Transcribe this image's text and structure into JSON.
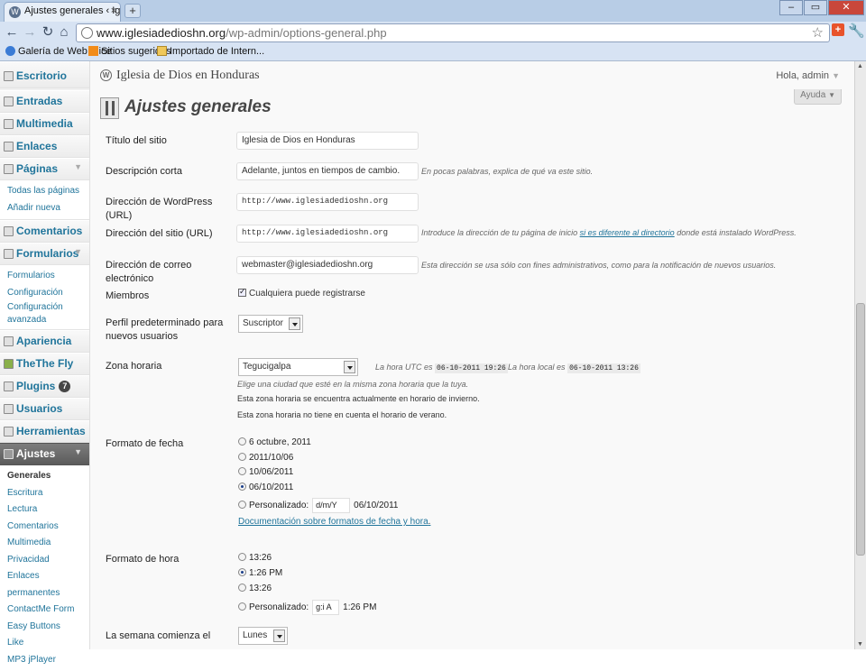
{
  "browser": {
    "tab_title": "Ajustes generales ‹ Iglesia d",
    "url_host": "www.iglesiadedioshn.org",
    "url_path": "/wp-admin/options-general.php",
    "bookmarks": [
      "Galería de Web Slice",
      "Sitios sugeridos",
      "Importado de Intern..."
    ]
  },
  "admin_bar": {
    "site_name": "Iglesia de Dios en Honduras",
    "greeting": "Hola, admin",
    "help": "Ayuda"
  },
  "sidebar": {
    "escritorio": "Escritorio",
    "entradas": "Entradas",
    "multimedia": "Multimedia",
    "enlaces": "Enlaces",
    "paginas": "Páginas",
    "paginas_sub": [
      "Todas las páginas",
      "Añadir nueva"
    ],
    "comentarios": "Comentarios",
    "formularios": "Formularios",
    "formularios_sub": [
      "Formularios",
      "Configuración",
      "Configuración",
      "avanzada"
    ],
    "apariencia": "Apariencia",
    "thethe": "TheThe Fly",
    "plugins": "Plugins",
    "plugins_count": "7",
    "usuarios": "Usuarios",
    "herramientas": "Herramientas",
    "ajustes": "Ajustes",
    "ajustes_sub": [
      "Generales",
      "Escritura",
      "Lectura",
      "Comentarios",
      "Multimedia",
      "Privacidad",
      "Enlaces permanentes",
      "ContactMe Form",
      "Easy Buttons",
      "Like",
      "MP3 jPlayer"
    ]
  },
  "page": {
    "title": "Ajustes generales",
    "fields": {
      "site_title_label": "Título del sitio",
      "site_title_value": "Iglesia de Dios en Honduras",
      "tagline_label": "Descripción corta",
      "tagline_value": "Adelante, juntos en tiempos de cambio.",
      "tagline_desc": "En pocas palabras, explica de qué va este sitio.",
      "wp_url_label": "Dirección de WordPress (URL)",
      "wp_url_value": "http://www.iglesiadedioshn.org",
      "site_url_label": "Dirección del sitio (URL)",
      "site_url_value": "http://www.iglesiadedioshn.org",
      "site_url_desc_a": "Introduce la dirección de tu página de inicio ",
      "site_url_desc_link": "si es diferente al directorio",
      "site_url_desc_b": " donde está instalado WordPress.",
      "email_label": "Dirección de correo electrónico",
      "email_value": "webmaster@iglesiadedioshn.org",
      "email_desc": "Esta dirección se usa sólo con fines administrativos, como para la notificación de nuevos usuarios.",
      "members_label": "Miembros",
      "members_check": "Cualquiera puede registrarse",
      "role_label": "Perfil predeterminado para nuevos usuarios",
      "role_value": "Suscriptor",
      "tz_label": "Zona horaria",
      "tz_value": "Tegucigalpa",
      "utc_prefix": "La hora UTC es",
      "utc_value": "06-10-2011 19:26",
      "local_prefix": "La hora local es",
      "local_value": "06-10-2011 13:26",
      "tz_hint": "Elige una ciudad que esté en la misma zona horaria que la tuya.",
      "tz_winter": "Esta zona horaria se encuentra actualmente en horario de invierno.",
      "tz_nodst": "Esta zona horaria no tiene en cuenta el horario de verano.",
      "date_label": "Formato de fecha",
      "date_options": [
        "6 octubre, 2011",
        "2011/10/06",
        "10/06/2011",
        "06/10/2011"
      ],
      "date_selected": 3,
      "date_custom_label": "Personalizado:",
      "date_custom_value": "d/m/Y",
      "date_custom_preview": "06/10/2011",
      "date_doc_link": "Documentación sobre formatos de fecha y hora",
      "date_doc_period": ".",
      "time_label": "Formato de hora",
      "time_options": [
        "13:26",
        "1:26 PM",
        "13:26"
      ],
      "time_selected": 1,
      "time_custom_label": "Personalizado:",
      "time_custom_value": "g:i A",
      "time_custom_preview": "1:26 PM",
      "week_label": "La semana comienza el",
      "week_value": "Lunes"
    }
  },
  "colors": {
    "link": "#21759b",
    "current_menu": "#6d6d6d",
    "close_button": "#c9473b"
  }
}
